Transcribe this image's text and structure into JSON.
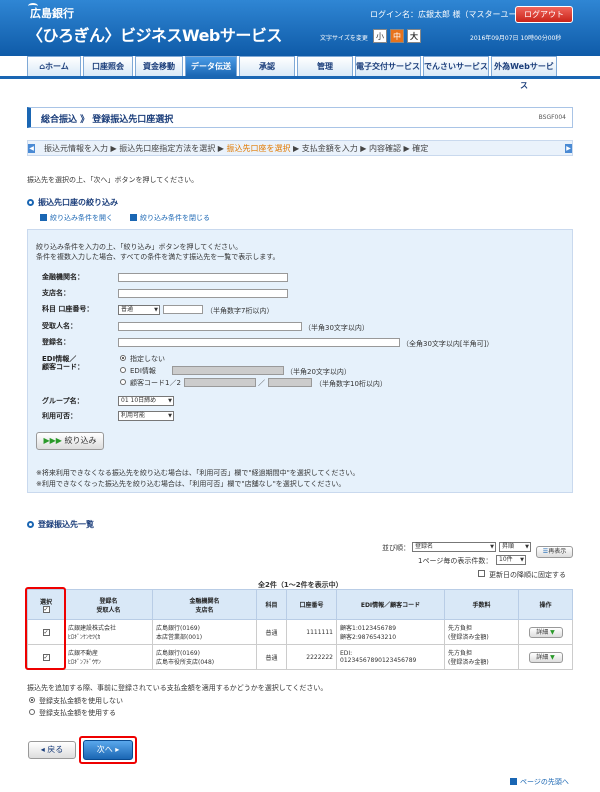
{
  "header": {
    "bank_name": "広島銀行",
    "service_name": "〈ひろぎん〉ビジネスWebサービス",
    "login": "ログイン名：広銀太郎 様（マスターユーザ）",
    "logout": "ログアウト",
    "font_size_label": "文字サイズを変更",
    "font_small": "小",
    "font_medium": "中",
    "font_large": "大",
    "datetime": "2016年09月07日 10時00分00秒"
  },
  "nav": [
    "ホーム",
    "口座照会",
    "資金移動",
    "データ伝送",
    "承認",
    "管理",
    "電子交付サービス",
    "でんさいサービス",
    "外為Webサービス"
  ],
  "page_title": "総合振込 》 登録振込先口座選択",
  "screen_code": "BSGF004",
  "steps": [
    "振込元情報を入力",
    "振込先口座指定方法を選択",
    "振込先口座を選択",
    "支払金額を入力",
    "内容確認",
    "確定"
  ],
  "instruction": "振込先を選択の上、「次へ」ボタンを押してください。",
  "filter": {
    "heading": "振込先口座の絞り込み",
    "open_link": "絞り込み条件を開く",
    "close_link": "絞り込み条件を閉じる",
    "desc1": "絞り込み条件を入力の上、「絞り込み」ボタンを押してください。",
    "desc2": "条件を複数入力した場合、すべての条件を満たす振込先を一覧で表示します。",
    "bank_label": "金融機関名：",
    "branch_label": "支店名：",
    "acct_label": "科目 口座番号：",
    "acct_type": "普通",
    "acct_hint": "（半角数字7桁以内）",
    "payee_label": "受取人名：",
    "payee_hint": "（半角30文字以内）",
    "reg_label": "登録名：",
    "reg_hint": "（全角30文字以内[半角可]）",
    "edi_label1": "EDI情報／",
    "edi_label2": "顧客コード：",
    "opt_none": "指定しない",
    "opt_edi": "EDI情報",
    "edi_hint": "（半角20文字以内）",
    "opt_cust": "顧客コード1／2",
    "cust_hint": "（半角数字10桁以内）",
    "group_label": "グループ名：",
    "group_value": "01 10日締め",
    "usable_label": "利用可否：",
    "usable_value": "利用可能",
    "filter_button": "絞り込み",
    "note1": "※将来利用できなくなる振込先を絞り込む場合は、「利用可否」欄で\"経過期間中\"を選択してください。",
    "note2": "※利用できなくなった振込先を絞り込む場合は、「利用可否」欄で\"店舗なし\"を選択してください。"
  },
  "list": {
    "heading": "登録振込先一覧",
    "sort_label": "並び順：",
    "sort_value": "登録名",
    "order_value": "昇順",
    "redisplay": "再表示",
    "perpage_label": "1ページ毎の表示件数：",
    "perpage_value": "10件",
    "fix_label": "更新日の降順に固定する",
    "count": "全2件（1〜2件を表示中）",
    "headers": {
      "select": "選択",
      "regname": "登録名",
      "payee": "受取人名",
      "bank": "金融機関名",
      "branch": "支店名",
      "type": "科目",
      "acct": "口座番号",
      "edi": "EDI情報／顧客コード",
      "fee": "手数料",
      "op": "操作"
    },
    "rows": [
      {
        "reg": "広銀建設株式会社",
        "payee": "ﾋﾛｷﾞﾝｹﾝｾﾂ(ｶ",
        "bank": "広島銀行(0169)",
        "branch": "本店営業部(001)",
        "type": "普通",
        "acct": "1111111",
        "edi1": "顧客1:0123456789",
        "edi2": "顧客2:9876543210",
        "fee1": "先方負担",
        "fee2": "(登録済み金額)",
        "detail": "詳細"
      },
      {
        "reg": "広銀不動産",
        "payee": "ﾋﾛｷﾞﾝﾌﾄﾞｳｻﾝ",
        "bank": "広島銀行(0169)",
        "branch": "広島市役所支店(048)",
        "type": "普通",
        "acct": "2222222",
        "edi1": "EDI:",
        "edi2": "01234567890123456789",
        "fee1": "先方負担",
        "fee2": "(登録済み金額)",
        "detail": "詳細"
      }
    ]
  },
  "amount": {
    "desc": "振込先を追加する際、事前に登録されている支払金額を適用するかどうかを選択してください。",
    "opt1": "登録支払金額を使用しない",
    "opt2": "登録支払金額を使用する"
  },
  "back_button": "戻る",
  "next_button": "次へ",
  "page_top": "ページの先頭へ"
}
